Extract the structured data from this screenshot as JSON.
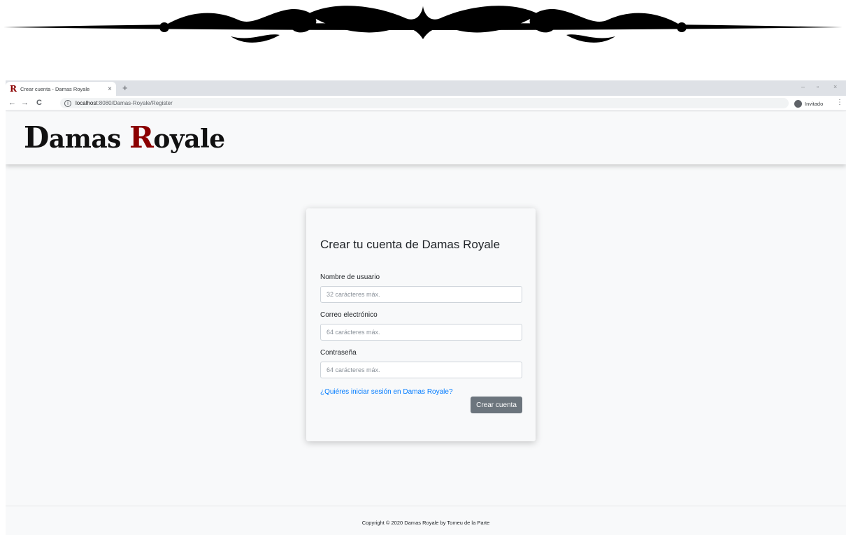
{
  "browser": {
    "tab": {
      "title": "Crear cuenta - Damas Royale",
      "favicon": "R",
      "close": "×"
    },
    "new_tab": "+",
    "window_controls": [
      "–",
      "▫",
      "×"
    ],
    "url_host": "localhost",
    "url_path": ":8080/Damas-Royale/Register",
    "profile_label": "Invitado"
  },
  "brand": {
    "part1_cap": "D",
    "part1_rest": "amas ",
    "part2_cap": "R",
    "part2_rest": "oyale",
    "accent_color": "#8b0000"
  },
  "form": {
    "title": "Crear tu cuenta de Damas Royale",
    "username_label": "Nombre de usuario",
    "username_placeholder": "32 carácteres máx.",
    "email_label": "Correo electrónico",
    "email_placeholder": "64 carácteres máx.",
    "password_label": "Contraseña",
    "password_placeholder": "64 carácteres máx.",
    "login_link": "¿Quiéres iniciar sesión en Damas Royale?",
    "submit_label": "Crear cuenta"
  },
  "footer": {
    "text": "Copyright © 2020 Damas Royale by Tomeu de la Parte"
  }
}
